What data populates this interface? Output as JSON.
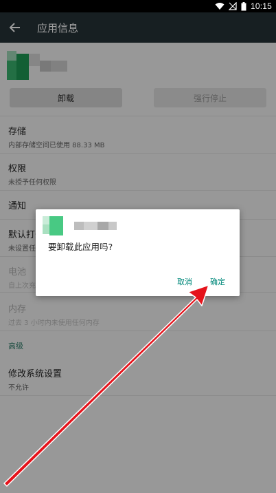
{
  "status_bar": {
    "time": "10:15"
  },
  "app_bar": {
    "title": "应用信息"
  },
  "buttons": {
    "uninstall": "卸载",
    "force_stop": "强行停止"
  },
  "settings": {
    "storage": {
      "title": "存储",
      "subtitle": "内部存储空间已使用 88.33 MB"
    },
    "permissions": {
      "title": "权限",
      "subtitle": "未授予任何权限"
    },
    "notifications": {
      "title": "通知"
    },
    "open_default": {
      "title": "默认打开",
      "subtitle": "未设置任"
    },
    "battery": {
      "title": "电池",
      "subtitle": "自上次充"
    },
    "memory": {
      "title": "内存",
      "subtitle": "过去 3 小时内未使用任何内存"
    },
    "advanced_section": "高级",
    "modify_system": {
      "title": "修改系统设置",
      "subtitle": "不允许"
    }
  },
  "dialog": {
    "message": "要卸载此应用吗?",
    "cancel": "取消",
    "confirm": "确定"
  },
  "colors": {
    "status_bar": "#000000",
    "app_bar": "#263238",
    "dialog_button": "#00897b",
    "arrow": "#e5131b"
  },
  "icons": [
    "wifi-icon",
    "signal-off-icon",
    "battery-icon",
    "back-arrow-icon"
  ]
}
